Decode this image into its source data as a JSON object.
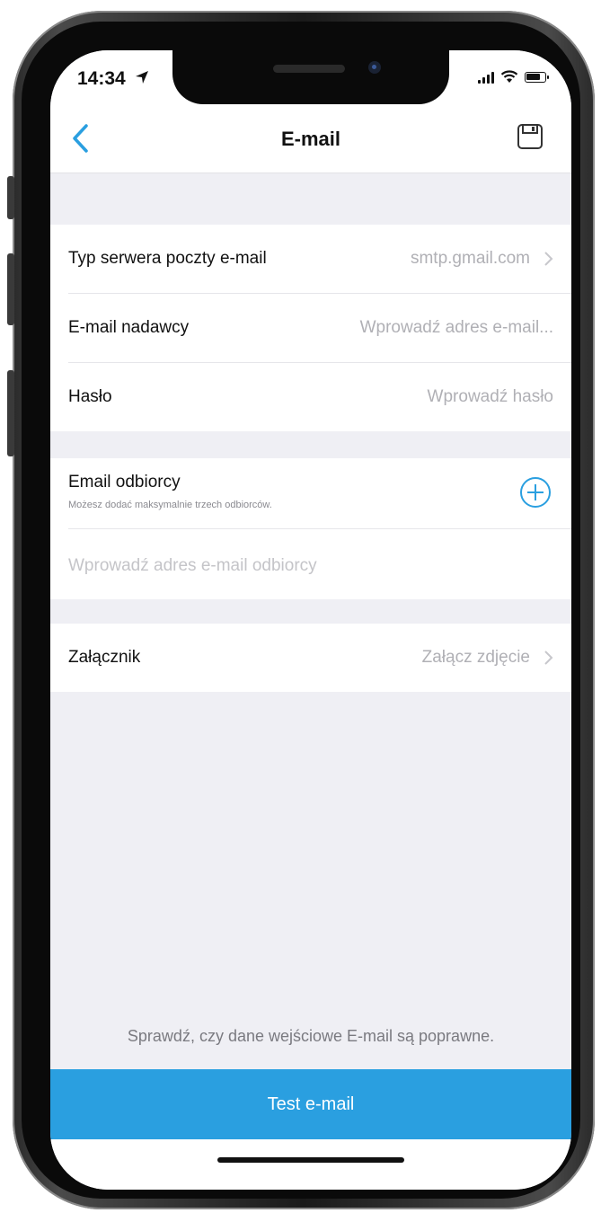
{
  "status_bar": {
    "time": "14:34"
  },
  "nav": {
    "title": "E-mail",
    "back_icon": "chevron-left-icon",
    "save_icon": "floppy-disk-icon"
  },
  "server_group": {
    "server_type": {
      "label": "Typ serwera poczty e-mail",
      "value": "smtp.gmail.com"
    },
    "sender": {
      "label": "E-mail nadawcy",
      "placeholder": "Wprowadź adres e-mail..."
    },
    "password": {
      "label": "Hasło",
      "placeholder": "Wprowadź hasło"
    }
  },
  "recipient_group": {
    "title": "Email odbiorcy",
    "hint": "Możesz dodać maksymalnie trzech odbiorców.",
    "placeholder": "Wprowadź adres e-mail odbiorcy"
  },
  "attachment": {
    "label": "Załącznik",
    "value": "Załącz zdjęcie"
  },
  "footer": {
    "hint": "Sprawdź, czy dane wejściowe E-mail są poprawne.",
    "test_button": "Test e-mail"
  },
  "colors": {
    "accent": "#2a9fe0",
    "background": "#efeff4"
  }
}
